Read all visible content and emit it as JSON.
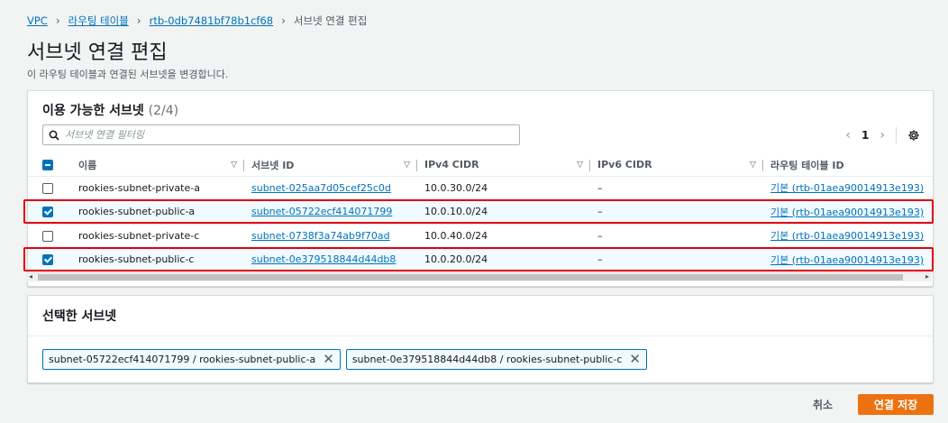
{
  "breadcrumb": {
    "items": [
      "VPC",
      "라우팅 테이블",
      "rtb-0db7481bf78b1cf68"
    ],
    "current": "서브넷 연결 편집"
  },
  "page": {
    "title": "서브넷 연결 편집",
    "description": "이 라우팅 테이블과 연결된 서브넷을 변경합니다."
  },
  "available": {
    "title": "이용 가능한 서브넷",
    "count": "(2/4)",
    "filter_placeholder": "서브넷 연결 필터링",
    "page_number": "1",
    "columns": [
      "이름",
      "서브넷 ID",
      "IPv4 CIDR",
      "IPv6 CIDR",
      "라우팅 테이블 ID"
    ],
    "rows": [
      {
        "name": "rookies-subnet-private-a",
        "subnet_id": "subnet-025aa7d05cef25c0d",
        "ipv4": "10.0.30.0/24",
        "ipv6": "–",
        "route_table": "기본 (rtb-01aea90014913e193)",
        "checked": false
      },
      {
        "name": "rookies-subnet-public-a",
        "subnet_id": "subnet-05722ecf414071799",
        "ipv4": "10.0.10.0/24",
        "ipv6": "–",
        "route_table": "기본 (rtb-01aea90014913e193)",
        "checked": true
      },
      {
        "name": "rookies-subnet-private-c",
        "subnet_id": "subnet-0738f3a74ab9f70ad",
        "ipv4": "10.0.40.0/24",
        "ipv6": "–",
        "route_table": "기본 (rtb-01aea90014913e193)",
        "checked": false
      },
      {
        "name": "rookies-subnet-public-c",
        "subnet_id": "subnet-0e379518844d44db8",
        "ipv4": "10.0.20.0/24",
        "ipv6": "–",
        "route_table": "기본 (rtb-01aea90014913e193)",
        "checked": true
      }
    ]
  },
  "selected": {
    "title": "선택한 서브넷",
    "tokens": [
      "subnet-05722ecf414071799 / rookies-subnet-public-a",
      "subnet-0e379518844d44db8 / rookies-subnet-public-c"
    ]
  },
  "actions": {
    "cancel": "취소",
    "save": "연결 저장"
  },
  "colors": {
    "link": "#0073bb",
    "primary": "#ec7211",
    "highlight": "#e3000f"
  }
}
